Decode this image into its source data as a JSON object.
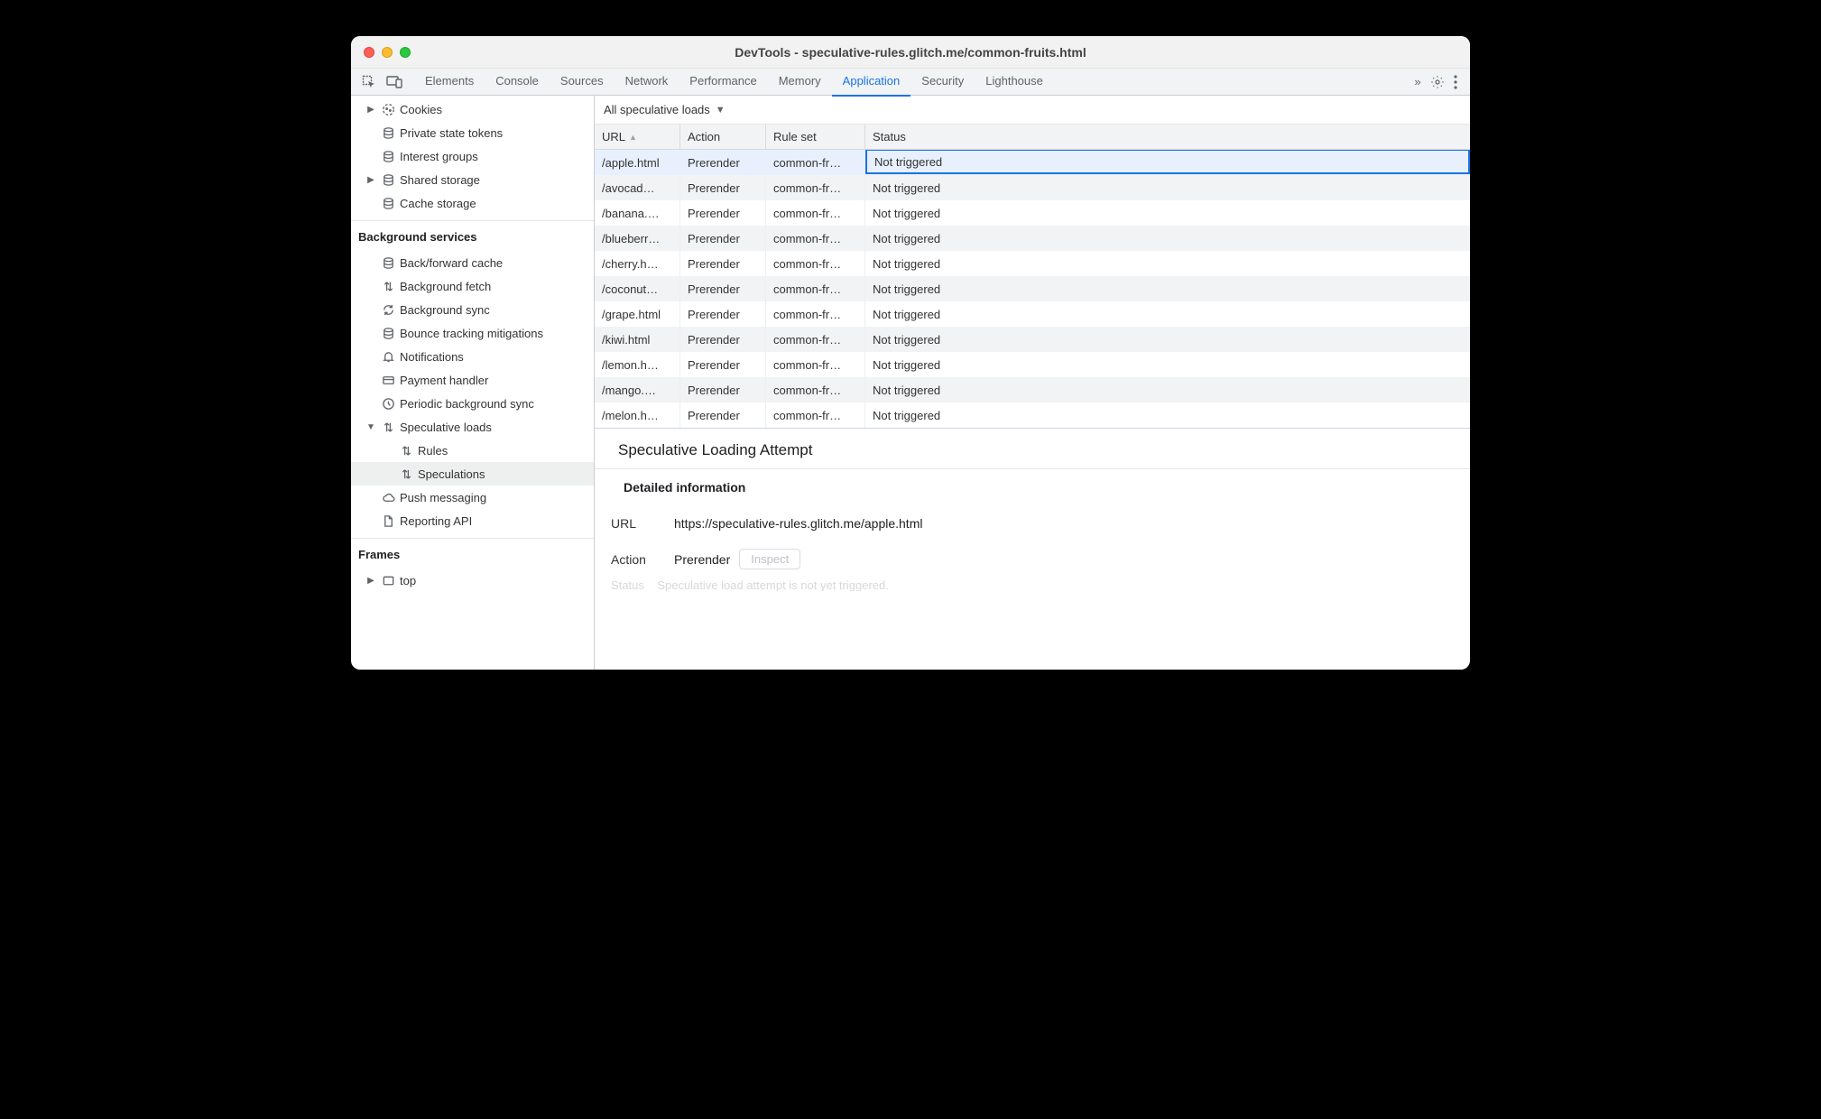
{
  "window": {
    "title": "DevTools - speculative-rules.glitch.me/common-fruits.html"
  },
  "tabs": {
    "items": [
      "Elements",
      "Console",
      "Sources",
      "Network",
      "Performance",
      "Memory",
      "Application",
      "Security",
      "Lighthouse"
    ],
    "active": "Application",
    "overflow_icon": "»"
  },
  "sidebar": {
    "storage_items": [
      {
        "label": "Cookies",
        "icon": "cookie",
        "expandable": true,
        "indent": 1
      },
      {
        "label": "Private state tokens",
        "icon": "db",
        "indent": 1
      },
      {
        "label": "Interest groups",
        "icon": "db",
        "indent": 1
      },
      {
        "label": "Shared storage",
        "icon": "db",
        "expandable": true,
        "indent": 1
      },
      {
        "label": "Cache storage",
        "icon": "db",
        "indent": 1
      }
    ],
    "bg_header": "Background services",
    "bg_items": [
      {
        "label": "Back/forward cache",
        "icon": "db",
        "indent": 1
      },
      {
        "label": "Background fetch",
        "icon": "vswap",
        "indent": 1
      },
      {
        "label": "Background sync",
        "icon": "sync",
        "indent": 1
      },
      {
        "label": "Bounce tracking mitigations",
        "icon": "db",
        "indent": 1
      },
      {
        "label": "Notifications",
        "icon": "bell",
        "indent": 1
      },
      {
        "label": "Payment handler",
        "icon": "card",
        "indent": 1
      },
      {
        "label": "Periodic background sync",
        "icon": "clock",
        "indent": 1
      },
      {
        "label": "Speculative loads",
        "icon": "vswap",
        "indent": 1,
        "expandable": true,
        "expanded": true
      },
      {
        "label": "Rules",
        "icon": "vswap",
        "indent": 2
      },
      {
        "label": "Speculations",
        "icon": "vswap",
        "indent": 2,
        "selected": true
      },
      {
        "label": "Push messaging",
        "icon": "cloud",
        "indent": 1
      },
      {
        "label": "Reporting API",
        "icon": "file",
        "indent": 1
      }
    ],
    "frames_header": "Frames",
    "frames_items": [
      {
        "label": "top",
        "icon": "frame",
        "expandable": true,
        "indent": 1
      }
    ]
  },
  "filter": {
    "label": "All speculative loads"
  },
  "table": {
    "headers": {
      "url": "URL",
      "action": "Action",
      "ruleset": "Rule set",
      "status": "Status"
    },
    "rows": [
      {
        "url": "/apple.html",
        "action": "Prerender",
        "ruleset": "common-fr…",
        "status": "Not triggered",
        "selected": true
      },
      {
        "url": "/avocad…",
        "action": "Prerender",
        "ruleset": "common-fr…",
        "status": "Not triggered"
      },
      {
        "url": "/banana.…",
        "action": "Prerender",
        "ruleset": "common-fr…",
        "status": "Not triggered"
      },
      {
        "url": "/blueberr…",
        "action": "Prerender",
        "ruleset": "common-fr…",
        "status": "Not triggered"
      },
      {
        "url": "/cherry.h…",
        "action": "Prerender",
        "ruleset": "common-fr…",
        "status": "Not triggered"
      },
      {
        "url": "/coconut…",
        "action": "Prerender",
        "ruleset": "common-fr…",
        "status": "Not triggered"
      },
      {
        "url": "/grape.html",
        "action": "Prerender",
        "ruleset": "common-fr…",
        "status": "Not triggered"
      },
      {
        "url": "/kiwi.html",
        "action": "Prerender",
        "ruleset": "common-fr…",
        "status": "Not triggered"
      },
      {
        "url": "/lemon.h…",
        "action": "Prerender",
        "ruleset": "common-fr…",
        "status": "Not triggered"
      },
      {
        "url": "/mango.…",
        "action": "Prerender",
        "ruleset": "common-fr…",
        "status": "Not triggered"
      },
      {
        "url": "/melon.h…",
        "action": "Prerender",
        "ruleset": "common-fr…",
        "status": "Not triggered"
      }
    ]
  },
  "detail": {
    "title": "Speculative Loading Attempt",
    "info_header": "Detailed information",
    "labels": {
      "url": "URL",
      "action": "Action",
      "status": "Status"
    },
    "url": "https://speculative-rules.glitch.me/apple.html",
    "action": "Prerender",
    "inspect": "Inspect",
    "status": "Speculative load attempt is not yet triggered."
  }
}
